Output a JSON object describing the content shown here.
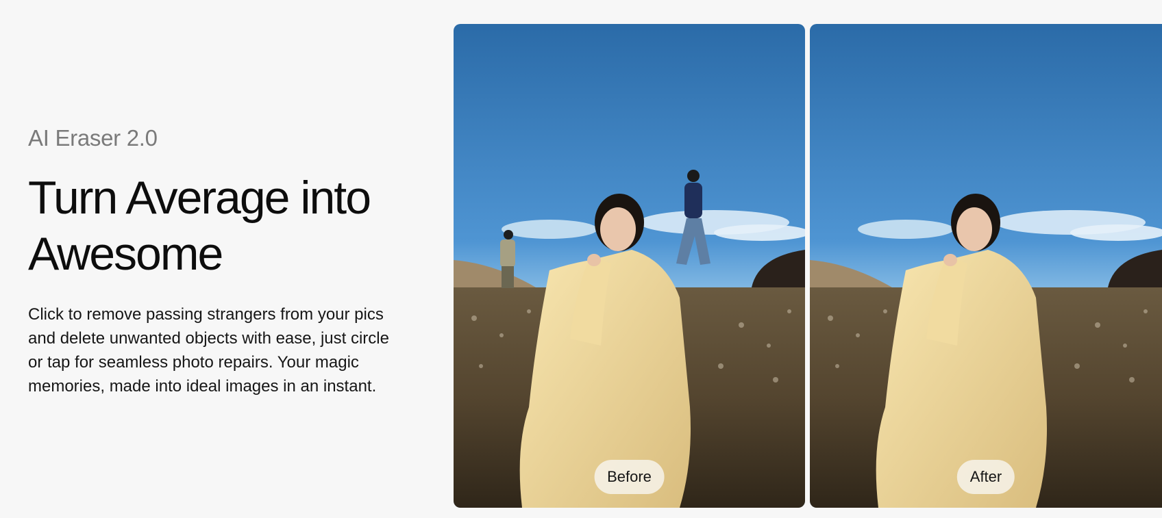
{
  "hero": {
    "eyebrow": "AI Eraser 2.0",
    "headline_line1": "Turn Average into",
    "headline_line2": "Awesome",
    "description": "Click to remove passing strangers from your pics and delete unwanted objects with ease, just circle or tap for seamless photo repairs. Your magic memories, made into ideal images in an instant."
  },
  "comparison": {
    "before_label": "Before",
    "after_label": "After"
  },
  "colors": {
    "page_background": "#f7f7f7",
    "eyebrow_text": "#7a7a7a",
    "headline_text": "#0d0d0d",
    "sky_top": "#2d6fae",
    "sky_bottom": "#8cc3ea",
    "dress": "#f3dda0",
    "label_pill": "#f5f1e6"
  }
}
